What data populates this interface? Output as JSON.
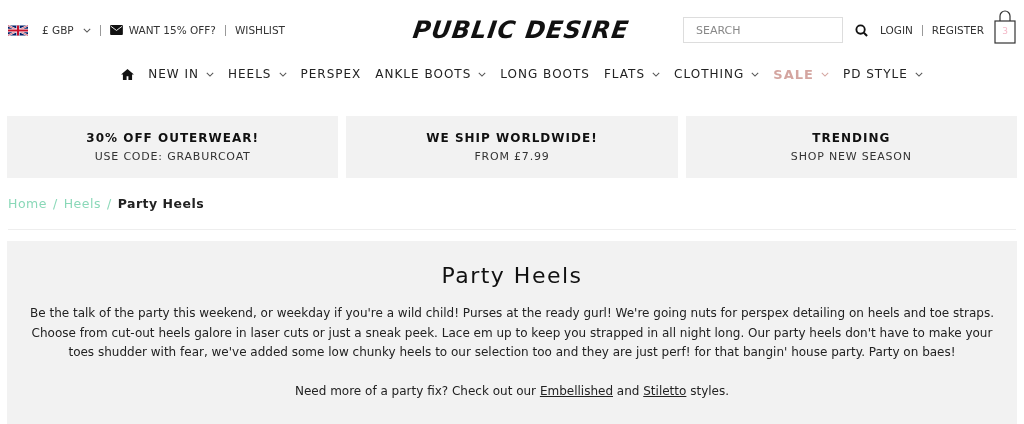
{
  "topbar": {
    "currency": "£ GBP",
    "offer": "WANT 15% OFF?",
    "wishlist": "WISHLIST"
  },
  "logo": "PUBLIC DESIRE",
  "search": {
    "placeholder": "SEARCH"
  },
  "account": {
    "login": "LOGIN",
    "register": "REGISTER"
  },
  "cart": {
    "count": "3"
  },
  "nav": [
    {
      "kind": "home"
    },
    {
      "kind": "link",
      "label": "NEW IN",
      "dropdown": true
    },
    {
      "kind": "link",
      "label": "HEELS",
      "dropdown": true
    },
    {
      "kind": "link",
      "label": "PERSPEX",
      "dropdown": false
    },
    {
      "kind": "link",
      "label": "ANKLE BOOTS",
      "dropdown": true
    },
    {
      "kind": "link",
      "label": "LONG BOOTS",
      "dropdown": false
    },
    {
      "kind": "link",
      "label": "FLATS",
      "dropdown": true
    },
    {
      "kind": "link",
      "label": "CLOTHING",
      "dropdown": true
    },
    {
      "kind": "sale",
      "label": "SALE",
      "dropdown": true
    },
    {
      "kind": "link",
      "label": "PD STYLE",
      "dropdown": true
    }
  ],
  "promos": [
    {
      "title": "30% OFF OUTERWEAR!",
      "subtitle": "USE CODE: GRABURCOAT"
    },
    {
      "title": "WE SHIP WORLDWIDE!",
      "subtitle": "FROM £7.99"
    },
    {
      "title": "TRENDING",
      "subtitle": "SHOP NEW SEASON"
    }
  ],
  "breadcrumb": [
    {
      "label": "Home",
      "selected": false
    },
    {
      "label": "Heels",
      "selected": false
    },
    {
      "label": "Party Heels",
      "selected": true
    }
  ],
  "breadcrumb_separator": "/",
  "category": {
    "title": "Party Heels",
    "description": "Be the talk of the party this weekend, or weekday if you're a wild child! Purses at the ready gurl! We're going nuts for perspex detailing on heels and toe straps. Choose from cut-out heels galore in laser cuts or just a sneak peek. Lace em up to keep you strapped in all night long. Our party heels don't have to make your toes shudder with fear, we've added some low chunky heels to our selection too and they are just perf! for that bangin' house party. Party on baes!",
    "more": [
      {
        "kind": "text",
        "text": "Need more of a party fix? Check out our "
      },
      {
        "kind": "link",
        "text": "Embellished"
      },
      {
        "kind": "text",
        "text": " and "
      },
      {
        "kind": "link",
        "text": "Stiletto"
      },
      {
        "kind": "text",
        "text": " styles."
      }
    ]
  }
}
